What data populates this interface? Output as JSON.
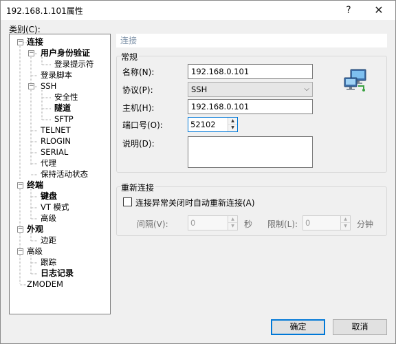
{
  "window": {
    "title": "192.168.1.101属性",
    "help_glyph": "?",
    "close_glyph": "✕"
  },
  "category_label": "类别(C):",
  "tree": {
    "items": [
      {
        "label": "连接",
        "bold": true,
        "expander": "−"
      },
      {
        "label": "用户身份验证",
        "bold": true,
        "expander": "−"
      },
      {
        "label": "登录提示符",
        "bold": false
      },
      {
        "label": "登录脚本",
        "bold": false
      },
      {
        "label": "SSH",
        "bold": false,
        "expander": "−"
      },
      {
        "label": "安全性",
        "bold": false
      },
      {
        "label": "隧道",
        "bold": true
      },
      {
        "label": "SFTP",
        "bold": false
      },
      {
        "label": "TELNET",
        "bold": false
      },
      {
        "label": "RLOGIN",
        "bold": false
      },
      {
        "label": "SERIAL",
        "bold": false
      },
      {
        "label": "代理",
        "bold": false
      },
      {
        "label": "保持活动状态",
        "bold": false
      },
      {
        "label": "终端",
        "bold": true,
        "expander": "−"
      },
      {
        "label": "键盘",
        "bold": true
      },
      {
        "label": "VT 模式",
        "bold": false
      },
      {
        "label": "高级",
        "bold": false
      },
      {
        "label": "外观",
        "bold": true,
        "expander": "−"
      },
      {
        "label": "边距",
        "bold": false
      },
      {
        "label": "高级",
        "bold": false,
        "expander": "−"
      },
      {
        "label": "跟踪",
        "bold": false
      },
      {
        "label": "日志记录",
        "bold": true
      },
      {
        "label": "ZMODEM",
        "bold": false
      }
    ]
  },
  "panel": {
    "header": "连接",
    "general": {
      "title": "常规",
      "name_label": "名称(N):",
      "name_value": "192.168.0.101",
      "protocol_label": "协议(P):",
      "protocol_value": "SSH",
      "host_label": "主机(H):",
      "host_value": "192.168.0.101",
      "port_label": "端口号(O):",
      "port_value": "52102",
      "desc_label": "说明(D):",
      "desc_value": ""
    },
    "reconnect": {
      "title": "重新连接",
      "checkbox_label": "连接异常关闭时自动重新连接(A)",
      "checked": false,
      "interval_label": "间隔(V):",
      "interval_value": "0",
      "interval_unit": "秒",
      "limit_label": "限制(L):",
      "limit_value": "0",
      "limit_unit": "分钟"
    }
  },
  "buttons": {
    "ok": "确定",
    "cancel": "取消"
  },
  "colors": {
    "accent": "#0078d7",
    "header_text": "#7a8fa6"
  }
}
